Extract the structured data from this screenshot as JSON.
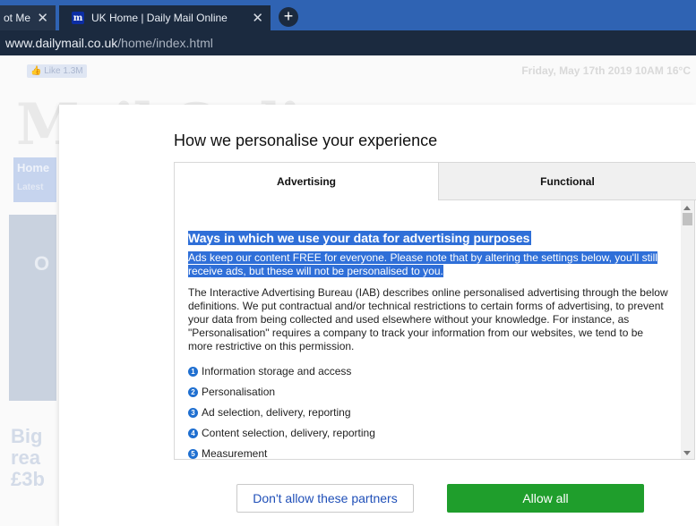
{
  "browser": {
    "tabs": [
      {
        "label": "ot Me",
        "active": false
      },
      {
        "label": "UK Home | Daily Mail Online",
        "active": true,
        "favicon": "m"
      }
    ],
    "address": {
      "host": "www.dailymail.co.uk",
      "path": "/home/index.html"
    }
  },
  "background_page": {
    "fb_like": "👍 Like 1.3M",
    "dateline": "Friday, May 17th 2019 10AM 16°C",
    "logo_text": "Mail Online",
    "nav": {
      "home": "Home",
      "latest": "Latest"
    },
    "hero_letter": "O",
    "headline_fragment": [
      "Big",
      "rea",
      "£3b"
    ]
  },
  "modal": {
    "title": "How we personalise your experience",
    "tabs": [
      {
        "label": "Advertising",
        "active": true
      },
      {
        "label": "Functional",
        "active": false
      }
    ],
    "section_title": "Ways in which we use your data for advertising purposes",
    "lead": "Ads keep our content FREE for everyone. Please note that by altering the settings below, you'll still receive ads, but these will not be personalised to you.",
    "description": "The Interactive Advertising Bureau (IAB) describes online personalised advertising through the below definitions. We put contractual and/or technical restrictions to certain forms of advertising, to prevent your data from being collected and used elsewhere without your knowledge. For instance, as \"Personalisation\" requires a company to track your information from our websites, we tend to be more restrictive on this permission.",
    "purposes": [
      {
        "num": "1",
        "label": "Information storage and access"
      },
      {
        "num": "2",
        "label": "Personalisation"
      },
      {
        "num": "3",
        "label": "Ad selection, delivery, reporting"
      },
      {
        "num": "4",
        "label": "Content selection, delivery, reporting"
      },
      {
        "num": "5",
        "label": "Measurement"
      }
    ],
    "buttons": {
      "deny": "Don't allow these partners",
      "allow": "Allow all"
    },
    "colors": {
      "allow_button": "#1f9e2c",
      "highlight": "#2f6fd8",
      "bullet": "#1f6fd0"
    }
  }
}
